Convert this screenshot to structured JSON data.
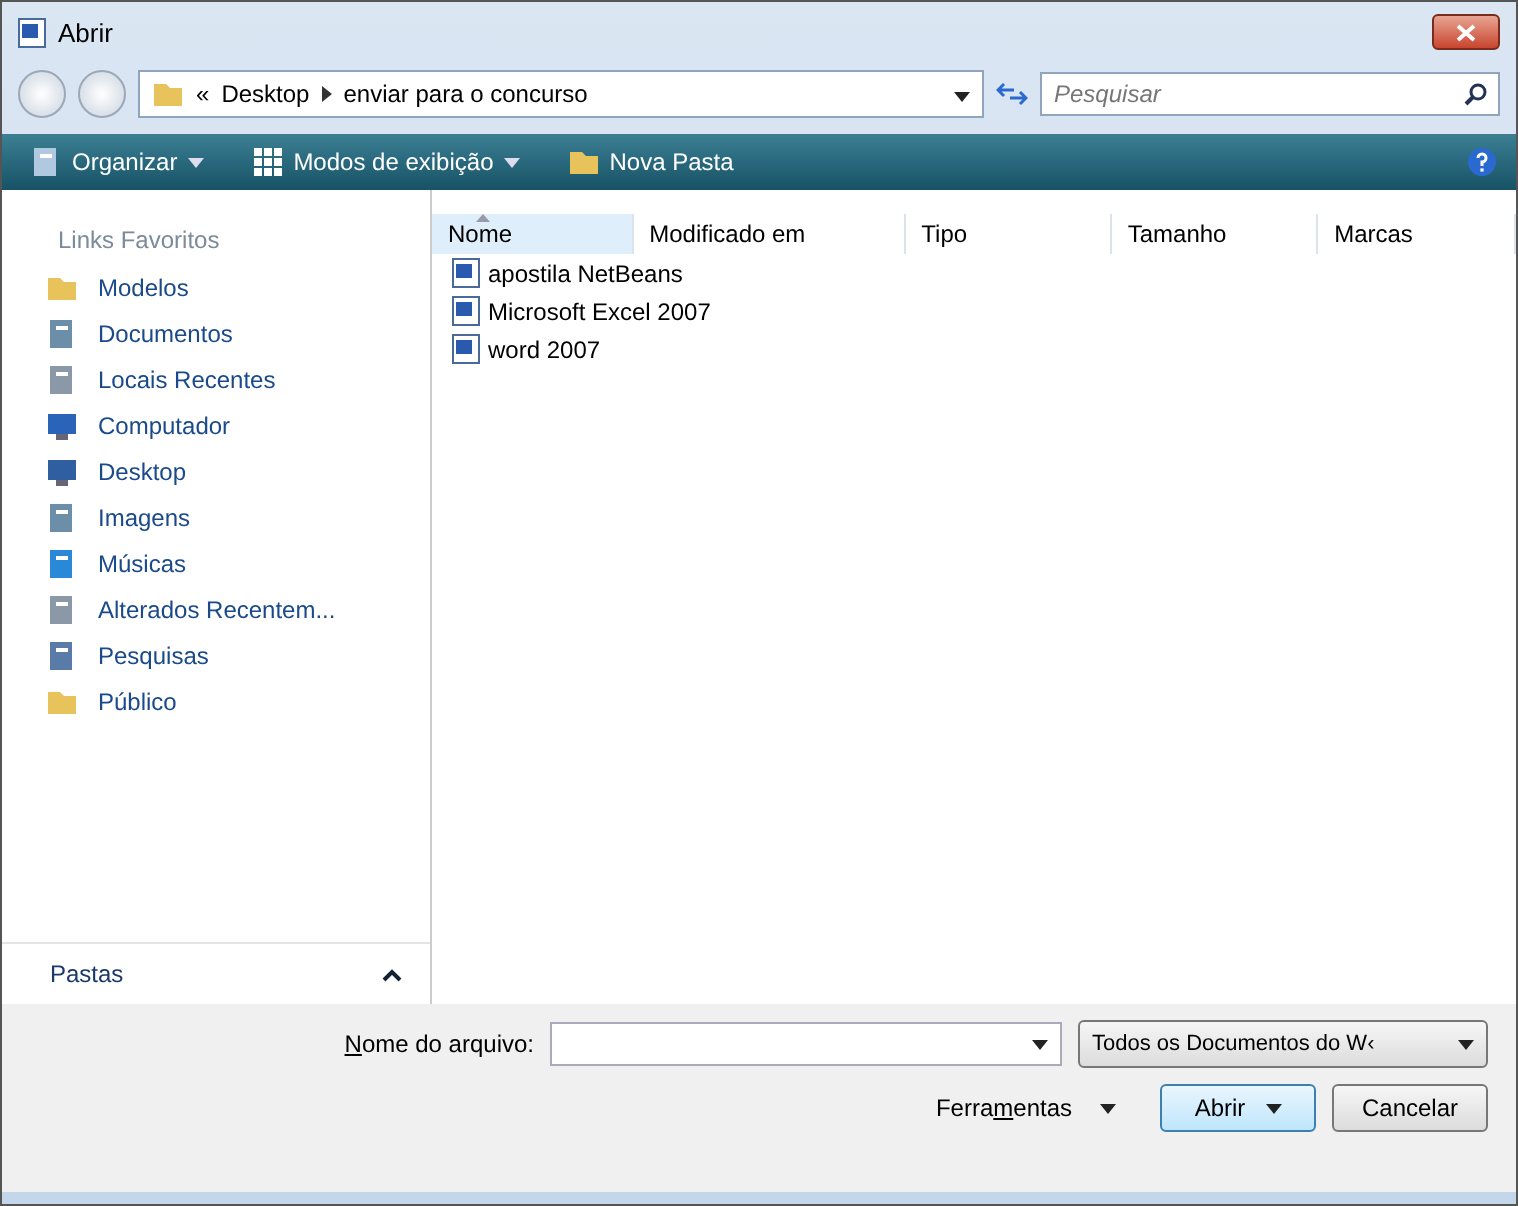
{
  "window": {
    "title": "Abrir"
  },
  "address": {
    "overflow": "«",
    "crumbs": [
      "Desktop",
      "enviar para o concurso"
    ]
  },
  "search": {
    "placeholder": "Pesquisar"
  },
  "toolbar": [
    {
      "label": "Organizar",
      "kind": "menu"
    },
    {
      "label": "Modos de exibição",
      "kind": "views"
    },
    {
      "label": "Nova Pasta",
      "kind": "folder"
    }
  ],
  "sidebar": {
    "heading": "Links Favoritos",
    "items": [
      {
        "label": "Modelos",
        "kind": "folder"
      },
      {
        "label": "Documentos",
        "kind": "docs"
      },
      {
        "label": "Locais Recentes",
        "kind": "recent"
      },
      {
        "label": "Computador",
        "kind": "computer"
      },
      {
        "label": "Desktop",
        "kind": "desktop"
      },
      {
        "label": "Imagens",
        "kind": "docs"
      },
      {
        "label": "Músicas",
        "kind": "music"
      },
      {
        "label": "Alterados Recentem...",
        "kind": "recent"
      },
      {
        "label": "Pesquisas",
        "kind": "search"
      },
      {
        "label": "Público",
        "kind": "folder"
      }
    ],
    "folders": {
      "label": "Pastas",
      "expanded": false
    }
  },
  "table": {
    "columns": [
      {
        "label": "Nome",
        "sorted": true
      },
      {
        "label": "Modificado em",
        "sorted": false
      },
      {
        "label": "Tipo",
        "sorted": false
      },
      {
        "label": "Tamanho",
        "sorted": false
      },
      {
        "label": "Marcas",
        "sorted": false
      }
    ],
    "rows": [
      "apostila NetBeans",
      "Microsoft Excel 2007",
      "word 2007"
    ]
  },
  "footer": {
    "filename_label": {
      "key": "N",
      "after": "ome do arquivo:"
    },
    "filter": "Todos os Documentos do W‹",
    "tools": {
      "before": "Ferra",
      "key": "m",
      "after": "entas"
    },
    "open": "Abrir",
    "cancel": "Cancelar"
  }
}
